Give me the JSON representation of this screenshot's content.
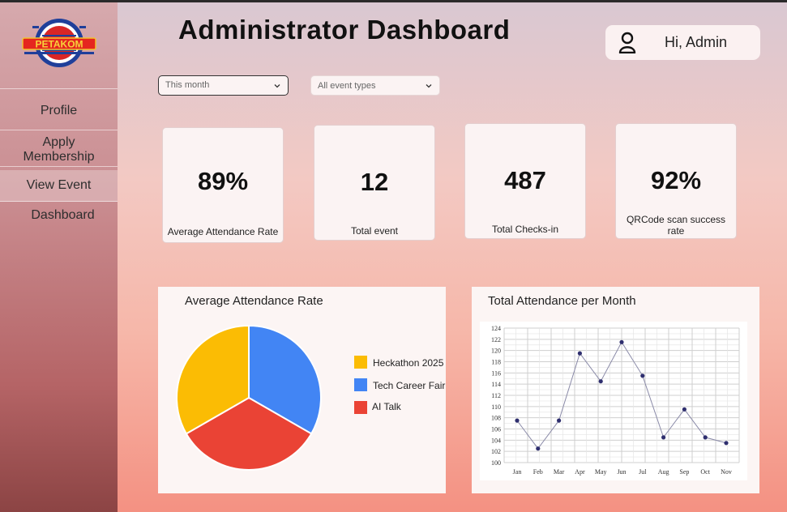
{
  "brand": {
    "logo_text": "PETAKOM"
  },
  "sidebar": {
    "items": [
      {
        "label": "Profile"
      },
      {
        "label": "Apply\nMembership"
      },
      {
        "label": "View Event"
      },
      {
        "label": "Dashboard"
      }
    ],
    "active_item": "View Event"
  },
  "header": {
    "title": "Administrator Dashboard",
    "greeting": "Hi, Admin"
  },
  "filters": {
    "period": {
      "value": "This month"
    },
    "event_type": {
      "value": "All event types"
    }
  },
  "kpis": [
    {
      "value": "89%",
      "label": "Average Attendance Rate"
    },
    {
      "value": "12",
      "label": "Total event"
    },
    {
      "value": "487",
      "label": "Total Checks-in"
    },
    {
      "value": "92%",
      "label": "QRCode scan success rate"
    }
  ],
  "colors": {
    "yellow": "#fbbc04",
    "blue": "#4285f4",
    "red": "#ea4335",
    "line": "#8a8aa8",
    "point": "#2e2e6e"
  },
  "chart_data": [
    {
      "type": "pie",
      "title": "Average Attendance Rate",
      "labels": [
        "Heckathon 2025",
        "Tech Career Fair",
        "AI Talk"
      ],
      "values": [
        33.3,
        33.3,
        33.4
      ],
      "colors": [
        "#fbbc04",
        "#4285f4",
        "#ea4335"
      ],
      "legend": "right"
    },
    {
      "type": "line",
      "title": "Total Attendance per Month",
      "x": [
        "Jan",
        "Feb",
        "Mar",
        "Apr",
        "May",
        "Jun",
        "Jul",
        "Aug",
        "Sep",
        "Oct",
        "Nov"
      ],
      "values": [
        107.5,
        102.5,
        107.5,
        119.5,
        114.5,
        121.5,
        115.5,
        104.5,
        109.5,
        104.5,
        103.5
      ],
      "ylim": [
        100,
        124
      ],
      "yticks": [
        100,
        102,
        104,
        106,
        108,
        110,
        112,
        114,
        116,
        118,
        120,
        122,
        124
      ],
      "grid": true,
      "xlabel": "",
      "ylabel": ""
    }
  ]
}
